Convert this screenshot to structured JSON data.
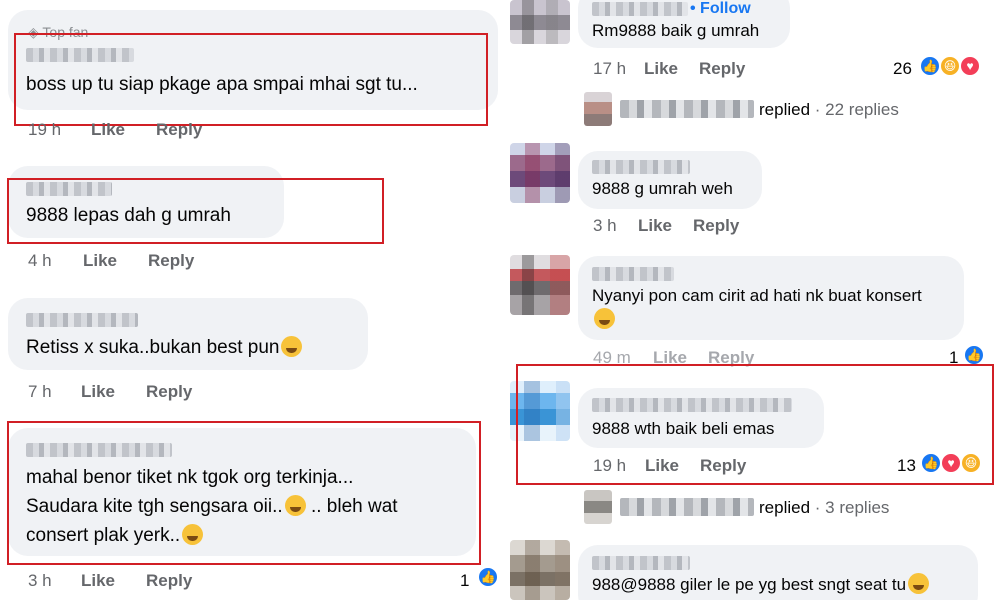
{
  "left": {
    "c1": {
      "badge": "Top fan",
      "text": "boss up tu siap pkage apa smpai mhai sgt tu...",
      "time": "19 h",
      "like": "Like",
      "reply": "Reply"
    },
    "c2": {
      "text": "9888 lepas dah g umrah",
      "time": "4 h",
      "like": "Like",
      "reply": "Reply"
    },
    "c3": {
      "text": "Retiss x suka..bukan best pun",
      "time": "7 h",
      "like": "Like",
      "reply": "Reply"
    },
    "c4": {
      "line1": "mahal benor tiket nk tgok org terkinja...",
      "line2": "Saudara kite tgh sengsara oii..",
      "line2b": ".. bleh wat",
      "line3": "consert plak yerk..",
      "time": "3 h",
      "like": "Like",
      "reply": "Reply",
      "reactions": "1"
    }
  },
  "right": {
    "c1": {
      "follow": "• Follow",
      "text": "Rm9888 baik g umrah",
      "time": "17 h",
      "like": "Like",
      "reply": "Reply",
      "reactions": "26"
    },
    "thread1": {
      "replied": "replied",
      "count": "· 22 replies"
    },
    "c2": {
      "text": "9888 g umrah weh",
      "time": "3 h",
      "like": "Like",
      "reply": "Reply"
    },
    "c3": {
      "text": "Nyanyi pon cam cirit ad hati nk buat konsert",
      "time": "49 m",
      "like": "Like",
      "reply": "Reply",
      "reactions": "1"
    },
    "c4": {
      "text": "9888 wth baik beli emas",
      "time": "19 h",
      "like": "Like",
      "reply": "Reply",
      "reactions": "13"
    },
    "thread2": {
      "replied": "replied",
      "count": "· 3 replies"
    },
    "c5": {
      "text": "988@9888 giler le pe yg best sngt seat tu"
    }
  },
  "colors": {
    "highlight": "#d11f25",
    "bubble": "#f0f2f5",
    "meta": "#65676b",
    "like_blue": "#1877f2"
  }
}
